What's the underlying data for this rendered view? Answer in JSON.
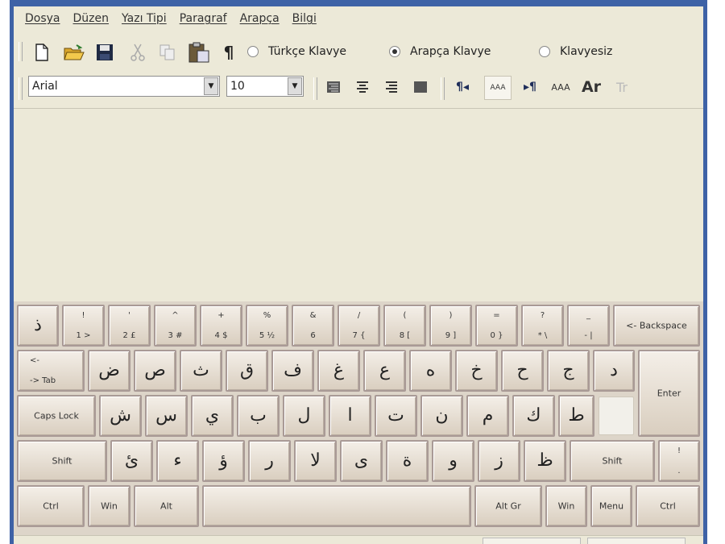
{
  "menu": [
    "Dosya",
    "Düzen",
    "Yazı Tipi",
    "Paragraf",
    "Arapça",
    "Bilgi"
  ],
  "toolbar": {
    "icons": [
      "new-file-icon",
      "open-folder-icon",
      "save-icon",
      "cut-icon",
      "copy-icon",
      "paste-icon",
      "paragraph-icon"
    ],
    "radios": [
      {
        "label": "Türkçe Klavye",
        "selected": false
      },
      {
        "label": "Arapça Klavye",
        "selected": true
      },
      {
        "label": "Klavyesiz",
        "selected": false
      }
    ]
  },
  "format": {
    "font": "Arial",
    "size": "10",
    "align_icons": [
      "align-right-icon",
      "align-center-icon",
      "align-left-icon",
      "justify-icon"
    ],
    "text_icons": [
      "rtl-paragraph-icon",
      "small-text-icon",
      "ltr-paragraph-icon",
      "medium-text-icon",
      "large-text-icon",
      "transliteration-icon"
    ],
    "size_labels": [
      "AAA",
      "AAA",
      "Ar",
      "Tr"
    ]
  },
  "keyboard": {
    "row1": [
      {
        "ar": "ذ"
      },
      {
        "top": "!",
        "bot": "1 >"
      },
      {
        "top": "'",
        "bot": "2 £"
      },
      {
        "top": "^",
        "bot": "3 #"
      },
      {
        "top": "+",
        "bot": "4 $"
      },
      {
        "top": "%",
        "bot": "5 ½"
      },
      {
        "top": "&",
        "bot": "6"
      },
      {
        "top": "/",
        "bot": "7 {"
      },
      {
        "top": "(",
        "bot": "8 ["
      },
      {
        "top": ")",
        "bot": "9 ]"
      },
      {
        "top": "=",
        "bot": "0 }"
      },
      {
        "top": "?",
        "bot": "* \\"
      },
      {
        "top": "_",
        "bot": "- |"
      },
      {
        "label": "<- Backspace"
      }
    ],
    "row2": [
      {
        "top": "<-",
        "bot": "-> Tab"
      },
      {
        "ar": "ض"
      },
      {
        "ar": "ص"
      },
      {
        "ar": "ث"
      },
      {
        "ar": "ق"
      },
      {
        "ar": "ف"
      },
      {
        "ar": "غ"
      },
      {
        "ar": "ع"
      },
      {
        "ar": "ه"
      },
      {
        "ar": "خ"
      },
      {
        "ar": "ح"
      },
      {
        "ar": "ج"
      },
      {
        "ar": "د"
      }
    ],
    "enter": "Enter",
    "row3": [
      {
        "label": "Caps Lock"
      },
      {
        "ar": "ش"
      },
      {
        "ar": "س"
      },
      {
        "ar": "ي"
      },
      {
        "ar": "ب"
      },
      {
        "ar": "ل"
      },
      {
        "ar": "ا"
      },
      {
        "ar": "ت"
      },
      {
        "ar": "ن"
      },
      {
        "ar": "م"
      },
      {
        "ar": "ك"
      },
      {
        "ar": "ط"
      }
    ],
    "row4": [
      {
        "label": "Shift"
      },
      {
        "ar": "ئ"
      },
      {
        "ar": "ء"
      },
      {
        "ar": "ؤ"
      },
      {
        "ar": "ر"
      },
      {
        "ar": "لا"
      },
      {
        "ar": "ى"
      },
      {
        "ar": "ة"
      },
      {
        "ar": "و"
      },
      {
        "ar": "ز"
      },
      {
        "ar": "ظ"
      },
      {
        "label": "Shift"
      },
      {
        "top": "!",
        "bot": "."
      }
    ],
    "row5": [
      {
        "label": "Ctrl"
      },
      {
        "label": "Win"
      },
      {
        "label": "Alt"
      },
      {
        "label": ""
      },
      {
        "label": "Alt Gr"
      },
      {
        "label": "Win"
      },
      {
        "label": "Menu"
      },
      {
        "label": "Ctrl"
      }
    ]
  }
}
